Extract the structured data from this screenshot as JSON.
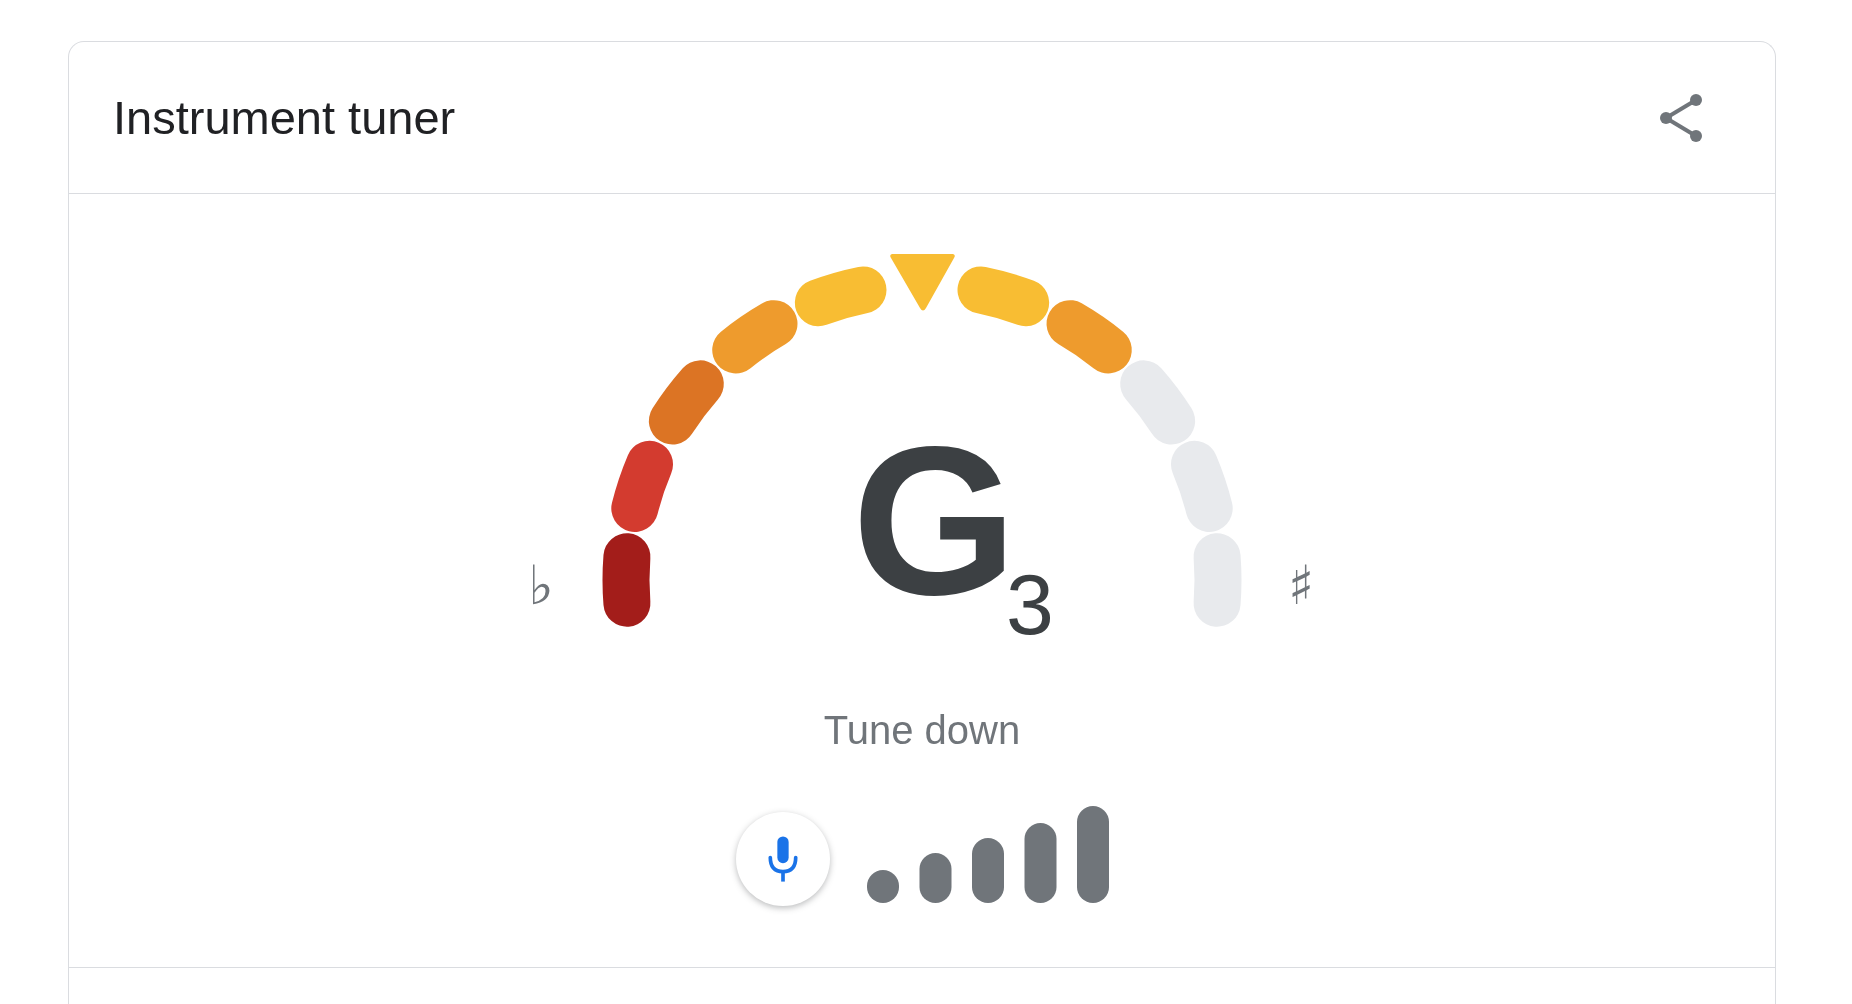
{
  "header": {
    "title": "Instrument tuner"
  },
  "tuner": {
    "flat_symbol": "♭",
    "sharp_symbol": "♯",
    "note": "G",
    "octave": "3",
    "segments": [
      {
        "color": "#a31d1a"
      },
      {
        "color": "#d33b2f"
      },
      {
        "color": "#dc7424"
      },
      {
        "color": "#ee9b2d"
      },
      {
        "color": "#f8bd33"
      },
      {
        "color": "#f8bd33"
      },
      {
        "color": "#ee9b2d"
      },
      {
        "color": "#e8eaed"
      },
      {
        "color": "#e8eaed"
      },
      {
        "color": "#e8eaed"
      }
    ],
    "instruction": "Tune down"
  },
  "input": {
    "listening": true
  }
}
